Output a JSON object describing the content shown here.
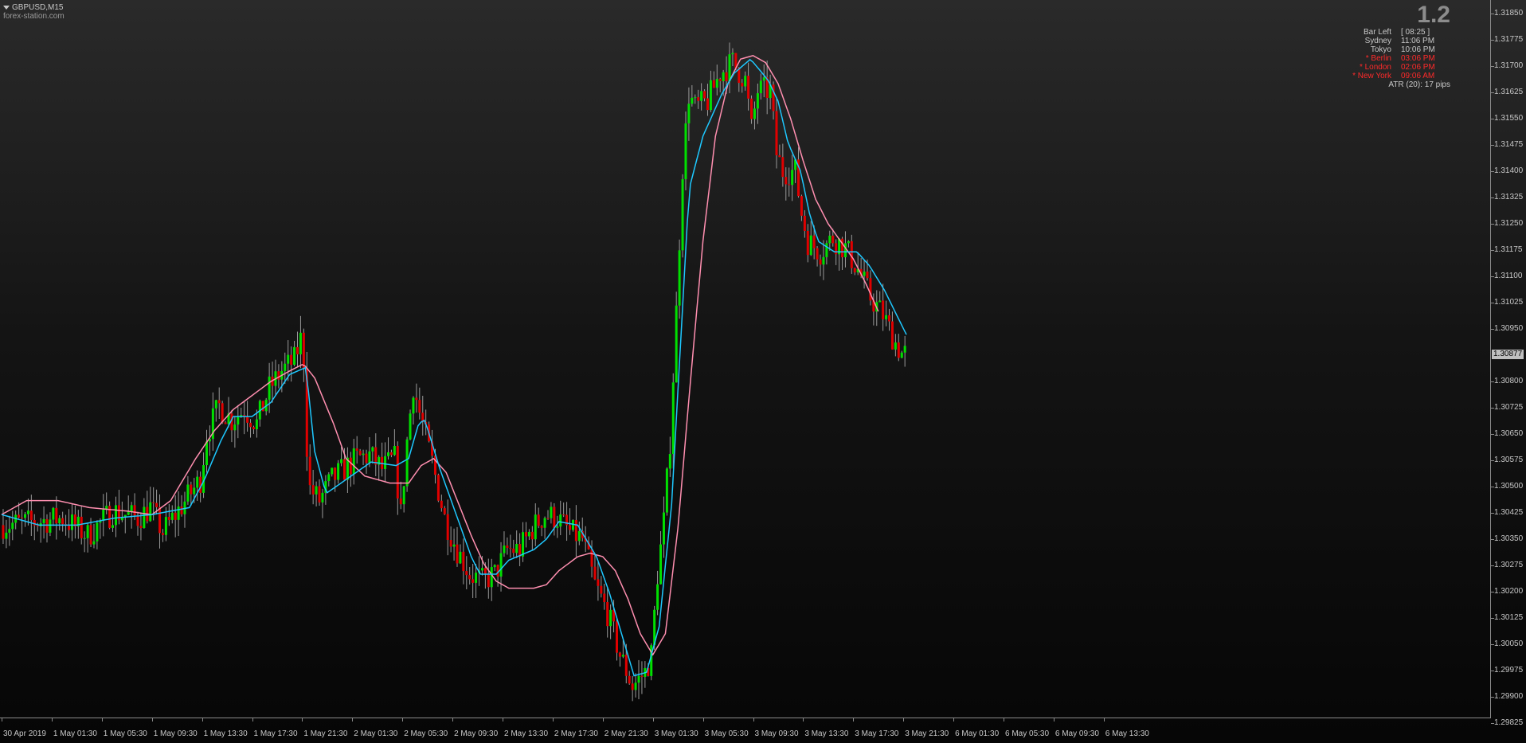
{
  "chart_header": {
    "symbol_timeframe": "GBPUSD,M15",
    "watermark": "forex-station.com"
  },
  "info_panel": {
    "big_value": "1.2",
    "rows": [
      {
        "name": "Bar Left",
        "value": "[ 08:25 ]",
        "color": "#c8c8c8"
      },
      {
        "name": "Sydney",
        "value": "11:06 PM",
        "color": "#c8c8c8"
      },
      {
        "name": "Tokyo",
        "value": "10:06 PM",
        "color": "#c8c8c8"
      },
      {
        "name": "* Berlin",
        "value": "03:06 PM",
        "color": "#ff2a2a"
      },
      {
        "name": "* London",
        "value": "02:06 PM",
        "color": "#ff2a2a"
      },
      {
        "name": "* New York",
        "value": "09:06 AM",
        "color": "#ff2a2a"
      }
    ],
    "atr": "ATR (20): 17 pips"
  },
  "price_axis": {
    "labels": [
      "1.31850",
      "1.31775",
      "1.31700",
      "1.31625",
      "1.31550",
      "1.31475",
      "1.31400",
      "1.31325",
      "1.31250",
      "1.31175",
      "1.31100",
      "1.31025",
      "1.30950",
      "1.30800",
      "1.30725",
      "1.30650",
      "1.30575",
      "1.30500",
      "1.30425",
      "1.30350",
      "1.30275",
      "1.30200",
      "1.30125",
      "1.30050",
      "1.29975",
      "1.29900",
      "1.29825"
    ],
    "current_price": "1.30877"
  },
  "time_axis": {
    "labels": [
      "30 Apr 2019",
      "1 May 01:30",
      "1 May 05:30",
      "1 May 09:30",
      "1 May 13:30",
      "1 May 17:30",
      "1 May 21:30",
      "2 May 01:30",
      "2 May 05:30",
      "2 May 09:30",
      "2 May 13:30",
      "2 May 17:30",
      "2 May 21:30",
      "3 May 01:30",
      "3 May 05:30",
      "3 May 09:30",
      "3 May 13:30",
      "3 May 17:30",
      "3 May 21:30",
      "6 May 01:30",
      "6 May 05:30",
      "6 May 09:30",
      "6 May 13:30"
    ]
  },
  "colors": {
    "bull": "#00e000",
    "bear": "#e00000",
    "fast_ma": "#1ec8ff",
    "slow_ma": "#ff8fb0",
    "wick": "#9a9a9a",
    "background_top": "#2a2a2a",
    "background_bottom": "#060606"
  },
  "chart_data": {
    "type": "line",
    "description_series": "Fast MA (cyan) and slow MA (pink) over M15 candles",
    "y_range": [
      1.29825,
      1.31875
    ],
    "x_labels": [
      "30 Apr 2019",
      "1 May 01:30",
      "1 May 05:30",
      "1 May 09:30",
      "1 May 13:30",
      "1 May 17:30",
      "1 May 21:30",
      "2 May 01:30",
      "2 May 05:30",
      "2 May 09:30",
      "2 May 13:30",
      "2 May 17:30",
      "2 May 21:30",
      "3 May 01:30",
      "3 May 05:30",
      "3 May 09:30",
      "3 May 13:30",
      "3 May 17:30",
      "3 May 21:30",
      "6 May 01:30",
      "6 May 05:30",
      "6 May 09:30",
      "6 May 13:30"
    ],
    "price_path": [
      [
        0,
        1.3039
      ],
      [
        3,
        1.304
      ],
      [
        5,
        1.3041
      ],
      [
        7,
        1.3036
      ],
      [
        9,
        1.3043
      ],
      [
        11,
        1.3041
      ],
      [
        12,
        1.3044
      ],
      [
        13,
        1.3037
      ],
      [
        15,
        1.3047
      ],
      [
        16,
        1.3052
      ],
      [
        16.5,
        1.3065
      ],
      [
        17.5,
        1.3073
      ],
      [
        18.5,
        1.3069
      ],
      [
        19.5,
        1.3072
      ],
      [
        20.5,
        1.3068
      ],
      [
        21.5,
        1.3078
      ],
      [
        22.5,
        1.3083
      ],
      [
        23.5,
        1.3086
      ],
      [
        24,
        1.3092
      ],
      [
        24.3,
        1.3085
      ],
      [
        24.6,
        1.305
      ],
      [
        25.5,
        1.3046
      ],
      [
        26.5,
        1.3052
      ],
      [
        27.5,
        1.3055
      ],
      [
        28.5,
        1.3058
      ],
      [
        29.5,
        1.3059
      ],
      [
        30.5,
        1.3055
      ],
      [
        31.5,
        1.3058
      ],
      [
        32,
        1.3042
      ],
      [
        32.5,
        1.3063
      ],
      [
        33,
        1.3079
      ],
      [
        33.5,
        1.3071
      ],
      [
        34.5,
        1.3057
      ],
      [
        35.5,
        1.3041
      ],
      [
        36.5,
        1.3032
      ],
      [
        37.5,
        1.3025
      ],
      [
        38.5,
        1.3023
      ],
      [
        39.5,
        1.3025
      ],
      [
        40.5,
        1.3032
      ],
      [
        41.5,
        1.3032
      ],
      [
        42.5,
        1.3038
      ],
      [
        43.5,
        1.3042
      ],
      [
        44.5,
        1.3041
      ],
      [
        45.5,
        1.3037
      ],
      [
        46.5,
        1.3035
      ],
      [
        47.5,
        1.3022
      ],
      [
        48.5,
        1.3014
      ],
      [
        49.5,
        1.3002
      ],
      [
        50.5,
        1.2993
      ],
      [
        51.5,
        1.2997
      ],
      [
        52,
        1.3002
      ],
      [
        52.5,
        1.3025
      ],
      [
        53,
        1.304
      ],
      [
        53.5,
        1.3063
      ],
      [
        54,
        1.31
      ],
      [
        54.5,
        1.3141
      ],
      [
        55,
        1.3162
      ],
      [
        55.5,
        1.3158
      ],
      [
        56.5,
        1.316
      ],
      [
        57.5,
        1.3168
      ],
      [
        58.5,
        1.3171
      ],
      [
        59.5,
        1.3166
      ],
      [
        60,
        1.3152
      ],
      [
        60.5,
        1.3163
      ],
      [
        61.5,
        1.3163
      ],
      [
        62,
        1.3145
      ],
      [
        62.5,
        1.314
      ],
      [
        63.5,
        1.314
      ],
      [
        64,
        1.3128
      ],
      [
        64.5,
        1.312
      ],
      [
        65.5,
        1.3117
      ],
      [
        66.5,
        1.3121
      ],
      [
        67.5,
        1.3118
      ],
      [
        68.5,
        1.3112
      ],
      [
        69.5,
        1.3104
      ],
      [
        70.5,
        1.3099
      ],
      [
        71.5,
        1.3091
      ],
      [
        72,
        1.3088
      ]
    ],
    "fast_ma": [
      [
        0,
        1.3042
      ],
      [
        3,
        1.3039
      ],
      [
        6,
        1.3039
      ],
      [
        9,
        1.3041
      ],
      [
        12,
        1.3042
      ],
      [
        15,
        1.3044
      ],
      [
        16.2,
        1.3052
      ],
      [
        17.5,
        1.3063
      ],
      [
        18.5,
        1.307
      ],
      [
        20,
        1.307
      ],
      [
        21.5,
        1.3074
      ],
      [
        23,
        1.3082
      ],
      [
        24.3,
        1.3084
      ],
      [
        25,
        1.306
      ],
      [
        25.9,
        1.3048
      ],
      [
        27.5,
        1.3052
      ],
      [
        29.5,
        1.3057
      ],
      [
        31.5,
        1.3056
      ],
      [
        32.5,
        1.3058
      ],
      [
        33.3,
        1.3068
      ],
      [
        33.8,
        1.3069
      ],
      [
        35,
        1.3055
      ],
      [
        36.5,
        1.304
      ],
      [
        37.5,
        1.303
      ],
      [
        38.2,
        1.3025
      ],
      [
        39.5,
        1.3025
      ],
      [
        40.5,
        1.3029
      ],
      [
        42.5,
        1.3032
      ],
      [
        43.5,
        1.3035
      ],
      [
        44.5,
        1.304
      ],
      [
        46,
        1.3039
      ],
      [
        47.5,
        1.303
      ],
      [
        48.5,
        1.302
      ],
      [
        49.5,
        1.3008
      ],
      [
        50.5,
        1.2996
      ],
      [
        51.5,
        1.2997
      ],
      [
        52.5,
        1.301
      ],
      [
        53.5,
        1.3045
      ],
      [
        54.2,
        1.309
      ],
      [
        54.9,
        1.3135
      ],
      [
        56,
        1.315
      ],
      [
        57.5,
        1.3162
      ],
      [
        58.5,
        1.3168
      ],
      [
        59.8,
        1.3172
      ],
      [
        61.2,
        1.3166
      ],
      [
        62,
        1.316
      ],
      [
        62.8,
        1.3148
      ],
      [
        63.8,
        1.314
      ],
      [
        64.5,
        1.3128
      ],
      [
        65.2,
        1.312
      ],
      [
        66.5,
        1.3117
      ],
      [
        68.3,
        1.3117
      ],
      [
        69.3,
        1.3113
      ],
      [
        70.5,
        1.3106
      ],
      [
        71.6,
        1.3098
      ],
      [
        72.3,
        1.3093
      ]
    ],
    "slow_ma": [
      [
        0,
        1.3042
      ],
      [
        2,
        1.3046
      ],
      [
        4.5,
        1.3046
      ],
      [
        7,
        1.3044
      ],
      [
        10,
        1.3043
      ],
      [
        12,
        1.3042
      ],
      [
        13.5,
        1.3046
      ],
      [
        15.5,
        1.3058
      ],
      [
        17,
        1.3066
      ],
      [
        18.5,
        1.3072
      ],
      [
        20,
        1.3076
      ],
      [
        21.5,
        1.308
      ],
      [
        23,
        1.3083
      ],
      [
        24.1,
        1.3085
      ],
      [
        25,
        1.3081
      ],
      [
        26.5,
        1.3068
      ],
      [
        27.5,
        1.3058
      ],
      [
        29,
        1.3053
      ],
      [
        31,
        1.3051
      ],
      [
        32.5,
        1.3051
      ],
      [
        33.5,
        1.3056
      ],
      [
        34.5,
        1.3058
      ],
      [
        35.5,
        1.3054
      ],
      [
        36.5,
        1.3045
      ],
      [
        37.5,
        1.3036
      ],
      [
        38.5,
        1.3028
      ],
      [
        39.5,
        1.3023
      ],
      [
        40.5,
        1.3021
      ],
      [
        42.5,
        1.3021
      ],
      [
        43.5,
        1.3022
      ],
      [
        44.5,
        1.3026
      ],
      [
        46,
        1.303
      ],
      [
        47,
        1.3031
      ],
      [
        48,
        1.303
      ],
      [
        49,
        1.3026
      ],
      [
        50,
        1.3018
      ],
      [
        51,
        1.3008
      ],
      [
        52,
        1.3002
      ],
      [
        53,
        1.3008
      ],
      [
        54,
        1.3038
      ],
      [
        55,
        1.308
      ],
      [
        56,
        1.312
      ],
      [
        57,
        1.315
      ],
      [
        58,
        1.3165
      ],
      [
        59,
        1.3172
      ],
      [
        60,
        1.3173
      ],
      [
        61,
        1.3171
      ],
      [
        62,
        1.3165
      ],
      [
        63,
        1.3155
      ],
      [
        64,
        1.3143
      ],
      [
        65,
        1.3132
      ],
      [
        66,
        1.3125
      ],
      [
        67,
        1.312
      ],
      [
        68,
        1.3115
      ],
      [
        69,
        1.3108
      ],
      [
        70,
        1.31
      ]
    ]
  }
}
